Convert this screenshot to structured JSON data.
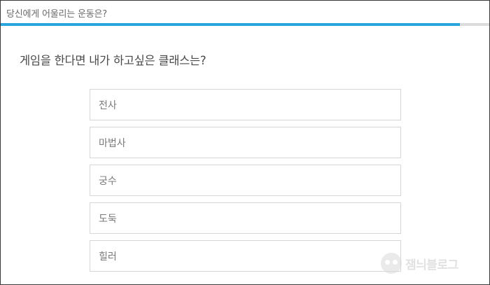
{
  "quiz": {
    "title": "당신에게 어울리는 운동은?",
    "progress": 0.94
  },
  "question": {
    "text": "게임을 한다면 내가 하고싶은 클래스는?"
  },
  "options": [
    {
      "label": "전사"
    },
    {
      "label": "마법사"
    },
    {
      "label": "궁수"
    },
    {
      "label": "도둑"
    },
    {
      "label": "힐러"
    }
  ],
  "watermark": {
    "text": "잼늬블로그"
  },
  "colors": {
    "progress_fill": "#29a4dc",
    "progress_track": "#dcdcdc",
    "border": "#d6d6d6",
    "text_muted": "#7a7a7a"
  }
}
